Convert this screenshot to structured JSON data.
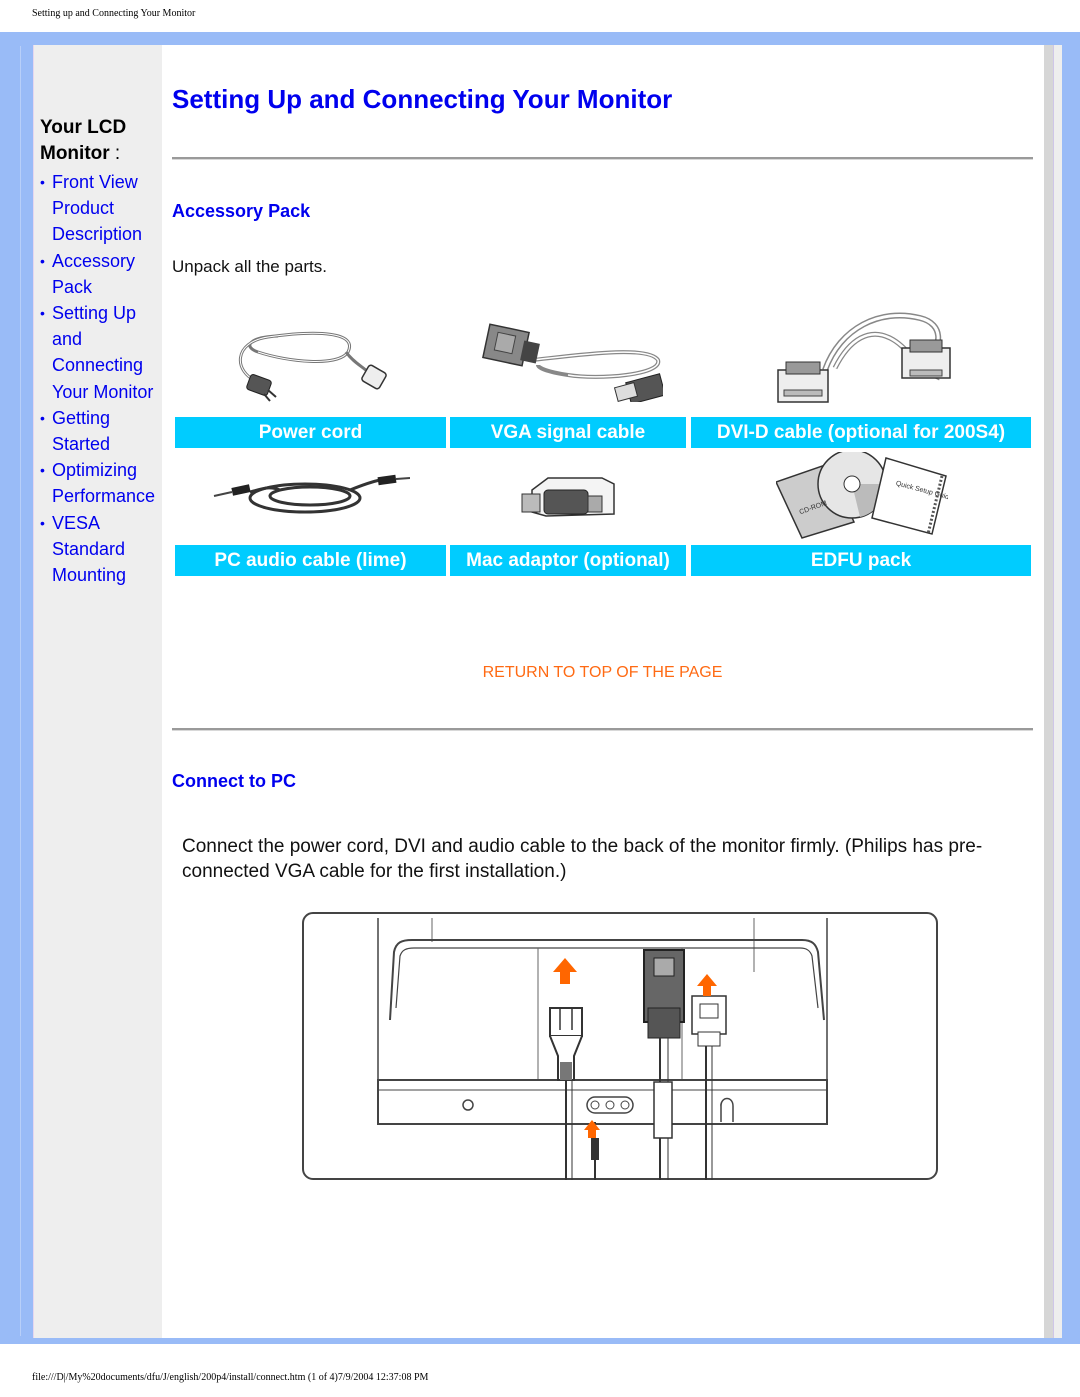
{
  "doc": {
    "header_title": "Setting up and Connecting Your Monitor",
    "footer_path": "file:///D|/My%20documents/dfu/J/english/200p4/install/connect.htm (1 of 4)7/9/2004 12:37:08 PM"
  },
  "sidebar": {
    "heading": "Your LCD Monitor",
    "heading_suffix": " :",
    "bullet": "•",
    "items": [
      {
        "label": "Front View Product Description"
      },
      {
        "label": "Accessory Pack"
      },
      {
        "label": "Setting Up and Connecting Your Monitor"
      },
      {
        "label": "Getting Started"
      },
      {
        "label": "Optimizing Performance"
      },
      {
        "label": "VESA Standard Mounting"
      }
    ]
  },
  "main": {
    "title": "Setting Up and Connecting Your Monitor",
    "accessory": {
      "heading": "Accessory Pack",
      "intro": "Unpack all the parts.",
      "items": [
        {
          "label": "Power cord",
          "icon": "power-cord-image"
        },
        {
          "label": "VGA signal cable",
          "icon": "vga-cable-image"
        },
        {
          "label": "DVI-D cable (optional for 200S4)",
          "icon": "dvi-cable-image"
        },
        {
          "label": "PC audio cable (lime)",
          "icon": "audio-cable-image"
        },
        {
          "label": "Mac adaptor (optional)",
          "icon": "mac-adaptor-image"
        },
        {
          "label": "EDFU pack",
          "icon": "edfu-pack-image"
        }
      ],
      "edfu_cd_text": "CD-ROM",
      "edfu_guide_text": "Quick Setup Guide"
    },
    "return_link": "RETURN TO TOP OF THE PAGE",
    "connect": {
      "heading": "Connect to PC",
      "text": "Connect the power cord, DVI and audio cable to the back of the monitor firmly. (Philips has pre-connected VGA cable for the first installation.)"
    }
  },
  "colors": {
    "frame": "#99bbf7",
    "link": "#0000ee",
    "caption_bg": "#00ccff",
    "return_link": "#ff6a13",
    "arrow": "#ff6600"
  }
}
